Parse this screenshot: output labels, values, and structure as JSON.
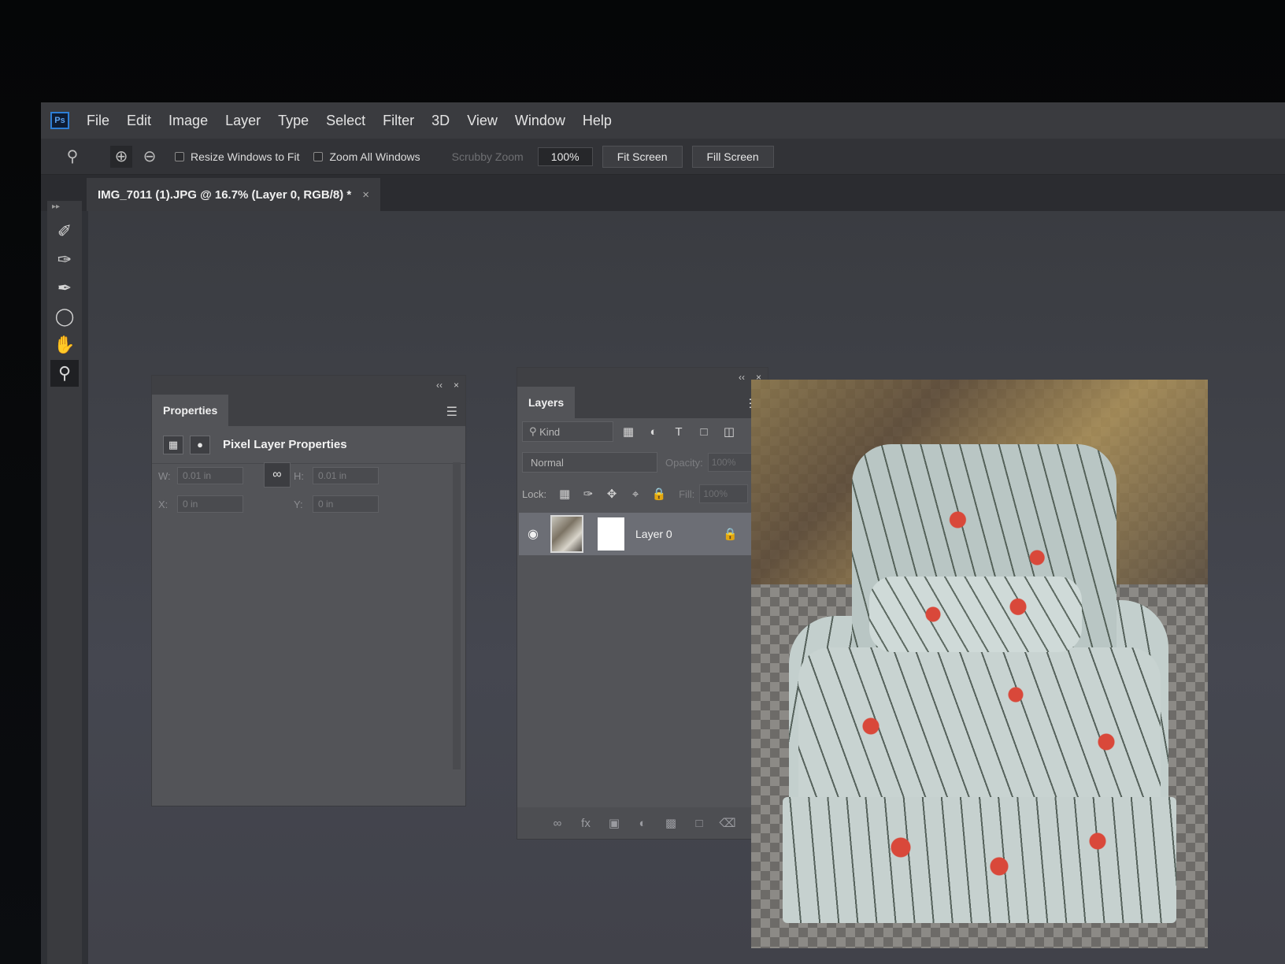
{
  "app": {
    "logo_text": "Ps"
  },
  "menu": [
    "File",
    "Edit",
    "Image",
    "Layer",
    "Type",
    "Select",
    "Filter",
    "3D",
    "View",
    "Window",
    "Help"
  ],
  "options_bar": {
    "resize_windows_label": "Resize Windows to Fit",
    "resize_windows_checked": false,
    "zoom_all_windows_label": "Zoom All Windows",
    "zoom_all_windows_checked": false,
    "scrubby_zoom_label": "Scrubby Zoom",
    "zoom_value": "100%",
    "fit_screen_label": "Fit Screen",
    "fill_screen_label": "Fill Screen"
  },
  "document_tab": {
    "title": "IMG_7011 (1).JPG @ 16.7% (Layer 0, RGB/8) *",
    "close_glyph": "×"
  },
  "tools": [
    "quick-selection-icon",
    "brush-icon",
    "spot-healing-icon",
    "lasso-icon",
    "hand-icon",
    "zoom-icon"
  ],
  "properties_panel": {
    "tab_label": "Properties",
    "section_title": "Pixel Layer Properties",
    "w_label": "W:",
    "w_value": "0.01 in",
    "h_label": "H:",
    "h_value": "0.01 in",
    "x_label": "X:",
    "x_value": "0 in",
    "y_label": "Y:",
    "y_value": "0 in"
  },
  "layers_panel": {
    "tab_label": "Layers",
    "filter_kind": "Kind",
    "blend_mode": "Normal",
    "opacity_label": "Opacity:",
    "opacity_value": "100%",
    "lock_label": "Lock:",
    "fill_label": "Fill:",
    "fill_value": "100%",
    "layers": [
      {
        "name": "Layer 0",
        "visible": true,
        "locked": true
      }
    ]
  },
  "panel_controls": {
    "collapse_glyph": "‹‹",
    "close_glyph": "×"
  },
  "colors": {
    "accent": "#2d7ed6",
    "panel_bg": "#535458",
    "selected_layer": "#6c6e75"
  }
}
